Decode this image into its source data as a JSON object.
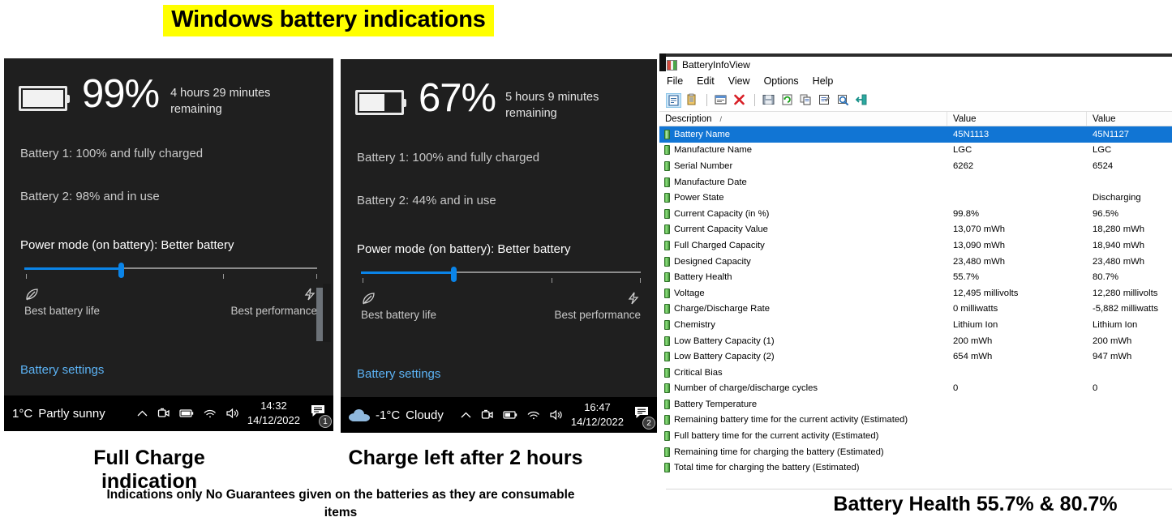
{
  "title": "Windows battery indications",
  "panels": [
    {
      "id": "left",
      "percent": "99%",
      "fill_ratio": 0.97,
      "remaining": "4 hours 29 minutes remaining",
      "battery1": "Battery 1: 100% and fully charged",
      "battery2": "Battery 2: 98% and in use",
      "power_mode": "Power mode (on battery): Better battery",
      "slider_value": 33,
      "endpoint_left": "Best battery life",
      "endpoint_right": "Best performance",
      "battery_settings": "Battery settings",
      "taskbar": {
        "temperature": "1°C",
        "weather": "Partly sunny",
        "show_cloud_icon": false,
        "time": "14:32",
        "date": "14/12/2022",
        "notification_count": "1",
        "tray_icons": [
          "chevron-up-icon",
          "camera-icon",
          "battery-icon",
          "wifi-icon",
          "volume-icon"
        ]
      }
    },
    {
      "id": "middle",
      "percent": "67%",
      "fill_ratio": 0.6,
      "remaining": "5 hours 9 minutes remaining",
      "battery1": "Battery 1: 100% and fully charged",
      "battery2": "Battery 2: 44% and in use",
      "power_mode": "Power mode (on battery): Better battery",
      "slider_value": 33,
      "endpoint_left": "Best battery life",
      "endpoint_right": "Best performance",
      "battery_settings": "Battery settings",
      "taskbar": {
        "temperature": "-1°C",
        "weather": "Cloudy",
        "show_cloud_icon": true,
        "time": "16:47",
        "date": "14/12/2022",
        "notification_count": "2",
        "tray_icons": [
          "chevron-up-icon",
          "camera-icon",
          "battery-icon",
          "wifi-icon",
          "volume-icon"
        ]
      }
    }
  ],
  "captions": {
    "left": "Full Charge indication",
    "middle": "Charge left after 2 hours",
    "note": "Indications only No Guarantees given on the batteries as they are consumable items",
    "right": "Battery Health 55.7% & 80.7%"
  },
  "battery_info_view": {
    "window_title": "BatteryInfoView",
    "menu": [
      "File",
      "Edit",
      "View",
      "Options",
      "Help"
    ],
    "toolbar_icons": [
      "properties-icon",
      "clipboard-icon",
      "separator",
      "report-icon",
      "delete-icon",
      "separator",
      "save-icon",
      "refresh-icon",
      "copy-icon",
      "options-icon",
      "find-icon",
      "exit-icon"
    ],
    "columns": [
      "Description",
      "Value",
      "Value"
    ],
    "sort_indicator": "/",
    "rows": [
      {
        "description": "Battery Name",
        "value1": "45N1113",
        "value2": "45N1127",
        "selected": true
      },
      {
        "description": "Manufacture Name",
        "value1": "LGC",
        "value2": "LGC",
        "selected": false
      },
      {
        "description": "Serial Number",
        "value1": " 6262",
        "value2": "6524",
        "selected": false
      },
      {
        "description": "Manufacture Date",
        "value1": "",
        "value2": "",
        "selected": false
      },
      {
        "description": "Power State",
        "value1": "",
        "value2": "Discharging",
        "selected": false
      },
      {
        "description": "Current Capacity (in %)",
        "value1": "99.8%",
        "value2": "96.5%",
        "selected": false
      },
      {
        "description": "Current Capacity Value",
        "value1": "13,070 mWh",
        "value2": "18,280 mWh",
        "selected": false
      },
      {
        "description": "Full Charged Capacity",
        "value1": "13,090 mWh",
        "value2": "18,940 mWh",
        "selected": false
      },
      {
        "description": "Designed Capacity",
        "value1": "23,480 mWh",
        "value2": "23,480 mWh",
        "selected": false
      },
      {
        "description": "Battery Health",
        "value1": "55.7%",
        "value2": "80.7%",
        "selected": false
      },
      {
        "description": "Voltage",
        "value1": "12,495 millivolts",
        "value2": "12,280 millivolts",
        "selected": false
      },
      {
        "description": "Charge/Discharge Rate",
        "value1": "0 milliwatts",
        "value2": "-5,882 milliwatts",
        "selected": false
      },
      {
        "description": "Chemistry",
        "value1": "Lithium Ion",
        "value2": "Lithium Ion",
        "selected": false
      },
      {
        "description": "Low Battery Capacity (1)",
        "value1": "200 mWh",
        "value2": "200 mWh",
        "selected": false
      },
      {
        "description": "Low Battery Capacity (2)",
        "value1": "654 mWh",
        "value2": "947 mWh",
        "selected": false
      },
      {
        "description": "Critical Bias",
        "value1": "",
        "value2": "",
        "selected": false
      },
      {
        "description": "Number of charge/discharge cycles",
        "value1": "0",
        "value2": "0",
        "selected": false
      },
      {
        "description": "Battery Temperature",
        "value1": "",
        "value2": "",
        "selected": false
      },
      {
        "description": "Remaining battery time for the current activity (Estimated)",
        "value1": "",
        "value2": "",
        "selected": false
      },
      {
        "description": "Full battery time for the current activity (Estimated)",
        "value1": "",
        "value2": "",
        "selected": false
      },
      {
        "description": "Remaining time for charging the battery (Estimated)",
        "value1": "",
        "value2": "",
        "selected": false
      },
      {
        "description": "Total  time for charging the battery (Estimated)",
        "value1": "",
        "value2": "",
        "selected": false
      }
    ]
  },
  "colors": {
    "highlight": "#ffff00",
    "accent_blue": "#0a84e8",
    "selection_blue": "#1175d4",
    "link_blue": "#5cb3f5",
    "panel_bg": "#1f1f1f"
  }
}
